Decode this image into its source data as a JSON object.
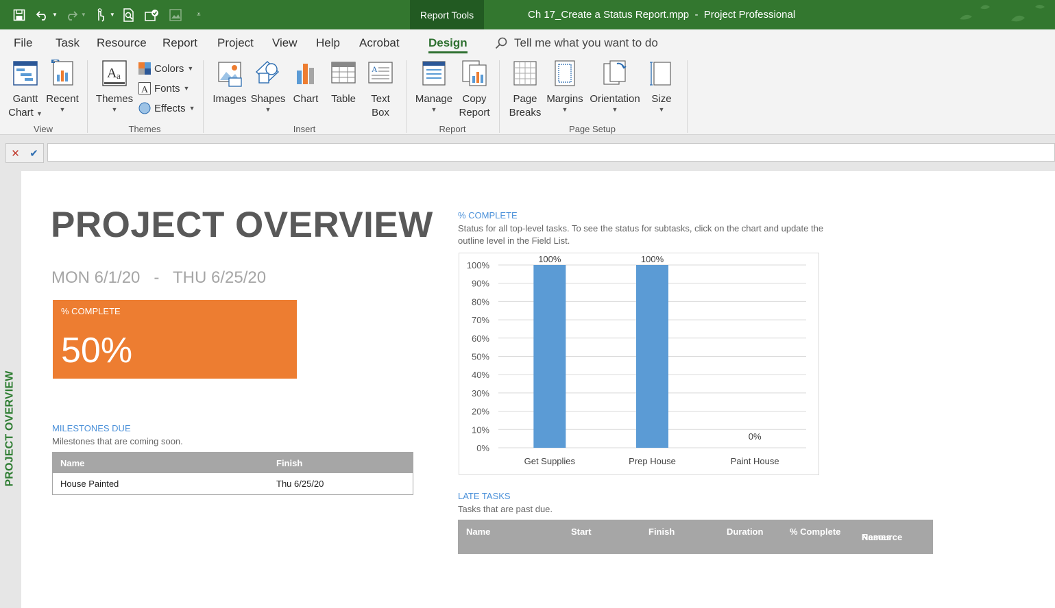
{
  "titlebar": {
    "context_tab": "Report Tools",
    "doc_title": "Ch 17_Create a Status Report.mpp  -  Project Professional"
  },
  "menu": {
    "tabs": [
      "File",
      "Task",
      "Resource",
      "Report",
      "Project",
      "View",
      "Help",
      "Acrobat",
      "Design"
    ],
    "active": "Design",
    "tell_me": "Tell me what you want to do"
  },
  "ribbon": {
    "view": {
      "label": "View",
      "gantt": [
        "Gantt",
        "Chart"
      ],
      "recent": "Recent"
    },
    "themes": {
      "label": "Themes",
      "themes": "Themes",
      "colors": "Colors",
      "fonts": "Fonts",
      "effects": "Effects"
    },
    "insert": {
      "label": "Insert",
      "images": "Images",
      "shapes": "Shapes",
      "chart": "Chart",
      "table": "Table",
      "textbox": [
        "Text",
        "Box"
      ]
    },
    "report": {
      "label": "Report",
      "manage": "Manage",
      "copy": [
        "Copy",
        "Report"
      ]
    },
    "page_setup": {
      "label": "Page Setup",
      "breaks": [
        "Page",
        "Breaks"
      ],
      "margins": "Margins",
      "orientation": "Orientation",
      "size": "Size"
    }
  },
  "side_label": "PROJECT OVERVIEW",
  "report": {
    "title": "PROJECT OVERVIEW",
    "start": "MON 6/1/20",
    "sep": "-",
    "finish": "THU 6/25/20",
    "card": {
      "label": "% COMPLETE",
      "value": "50%",
      "color": "#ed7d31"
    },
    "milestones": {
      "title": "MILESTONES DUE",
      "desc": "Milestones that are coming soon.",
      "headers": [
        "Name",
        "Finish"
      ],
      "rows": [
        [
          "House Painted",
          "Thu 6/25/20"
        ]
      ]
    },
    "complete_chart": {
      "title": "% COMPLETE",
      "desc1": "Status for all top-level tasks. To see the status for subtasks, click on the chart and update the",
      "desc2": "outline level in the Field List."
    },
    "late": {
      "title": "LATE TASKS",
      "desc": "Tasks that are past due.",
      "headers": [
        "Name",
        "Start",
        "Finish",
        "Duration",
        "% Complete",
        "Resource",
        "Names"
      ]
    }
  },
  "chart_data": {
    "type": "bar",
    "categories": [
      "Get Supplies",
      "Prep House",
      "Paint House"
    ],
    "values": [
      100,
      100,
      0
    ],
    "data_labels": [
      "100%",
      "100%",
      "0%"
    ],
    "yticks": [
      "0%",
      "10%",
      "20%",
      "30%",
      "40%",
      "50%",
      "60%",
      "70%",
      "80%",
      "90%",
      "100%"
    ],
    "ylim": [
      0,
      100
    ],
    "grid": true,
    "bar_color": "#5b9bd5"
  }
}
